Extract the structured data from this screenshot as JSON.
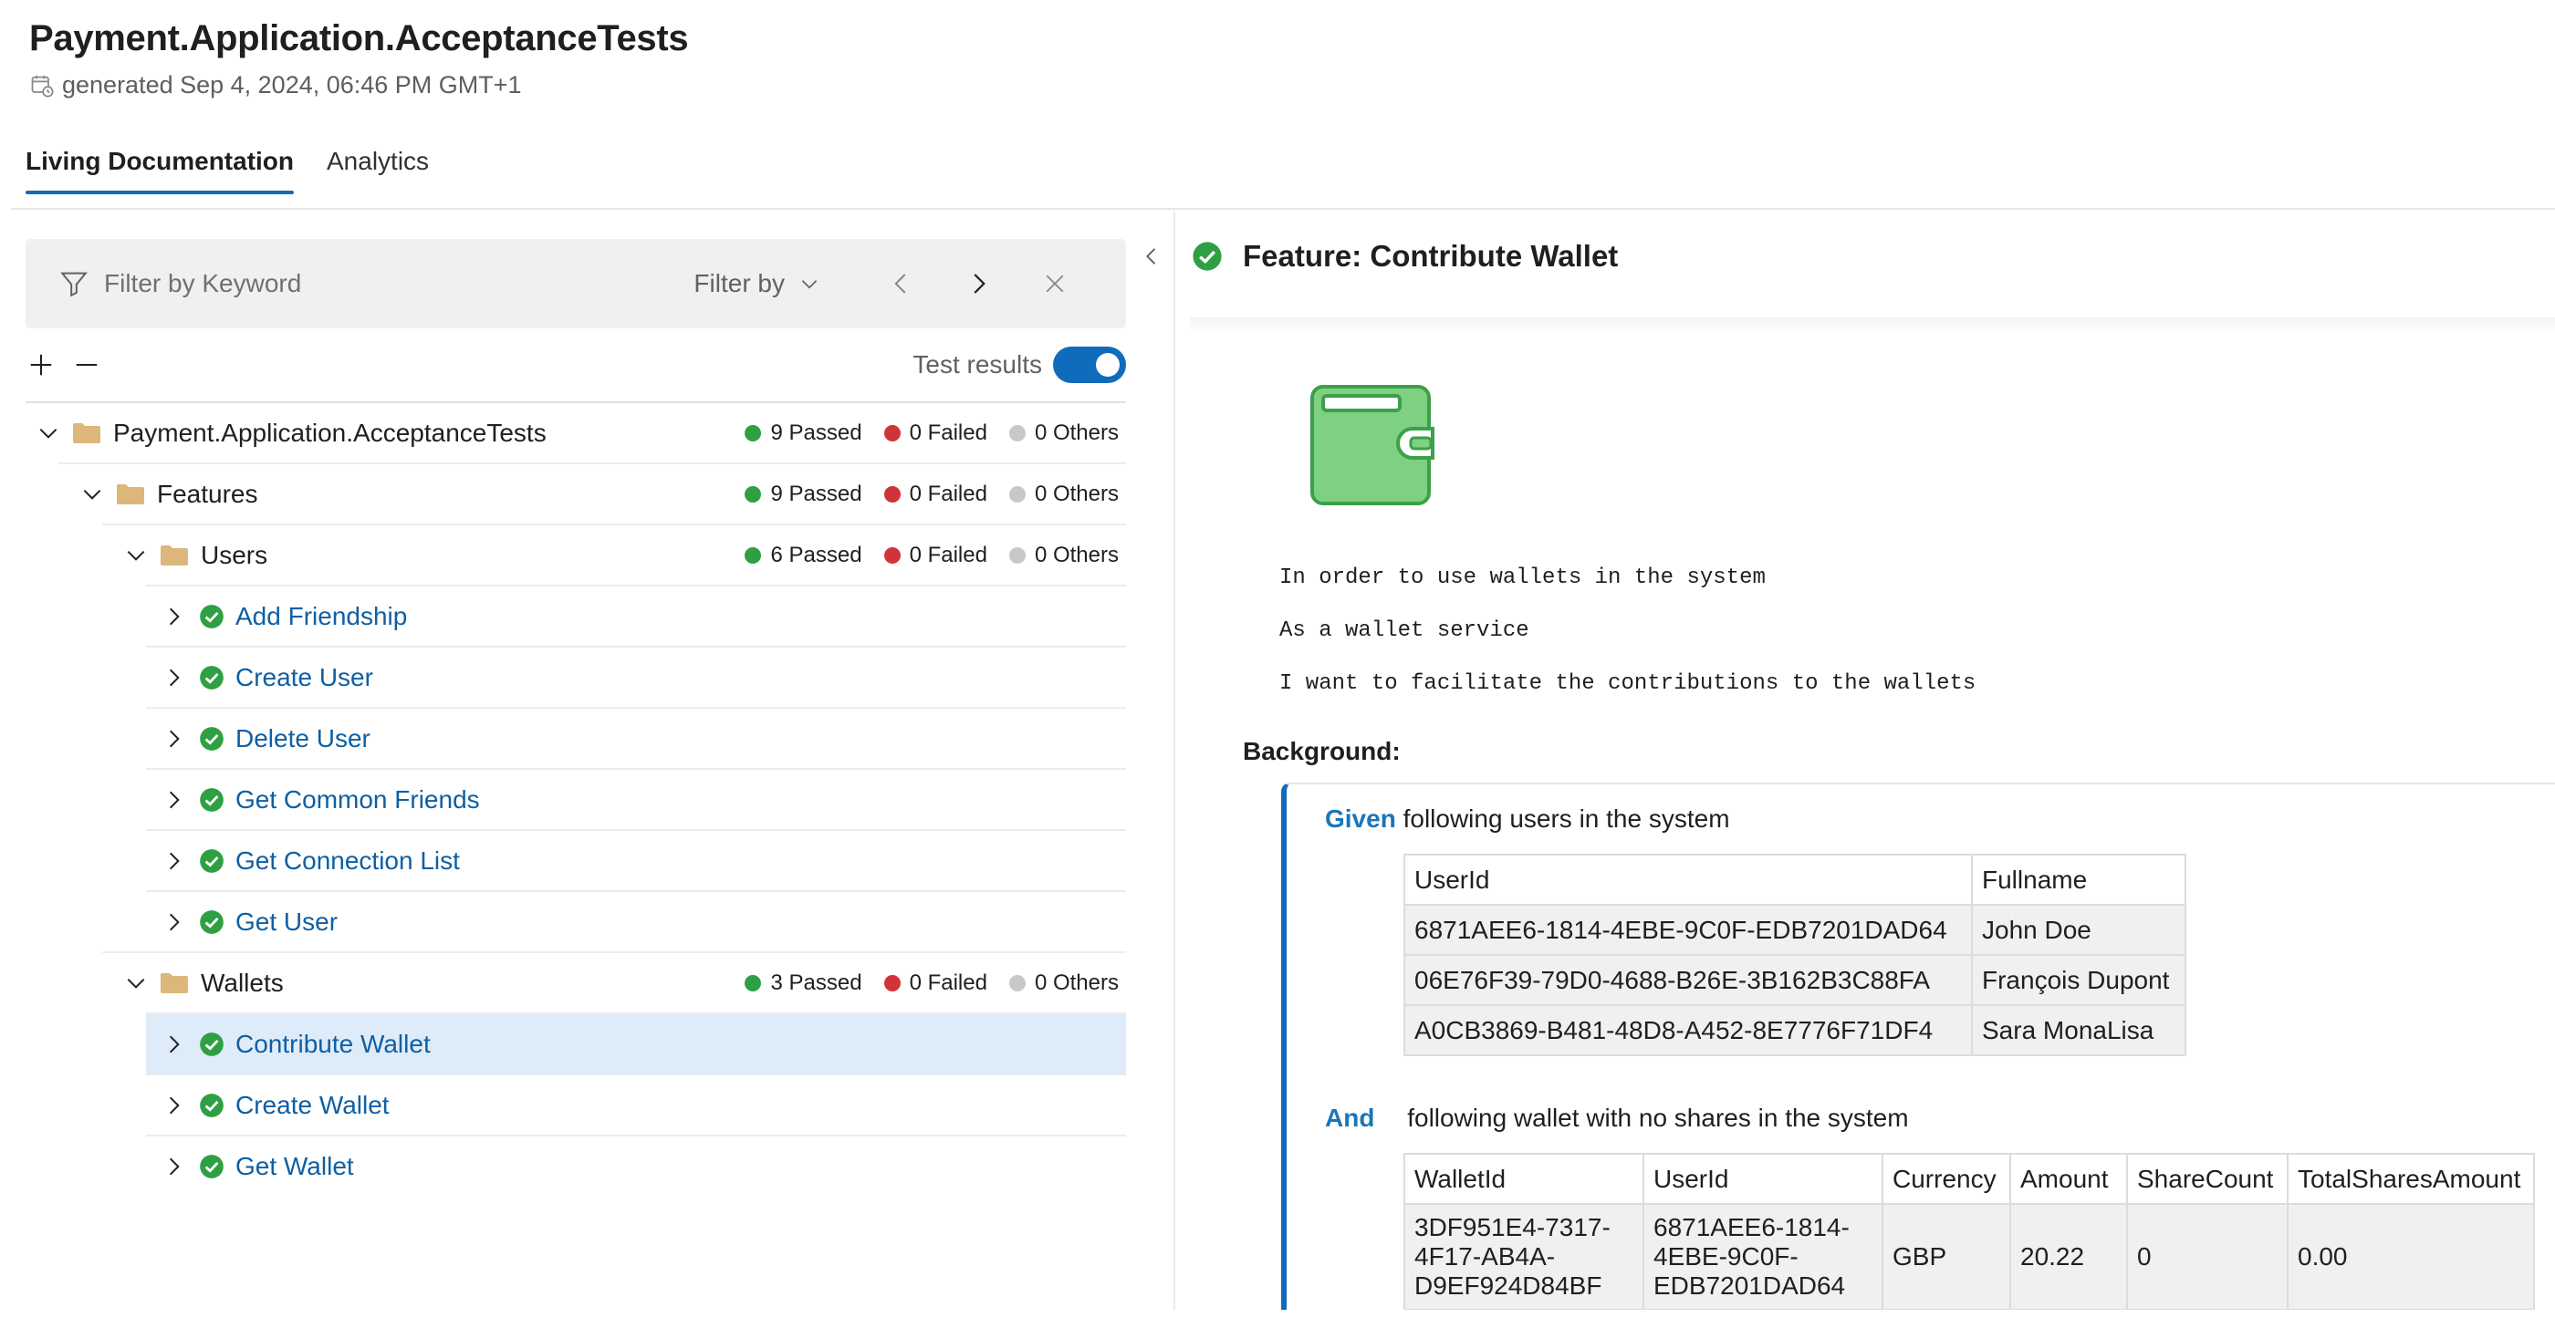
{
  "header": {
    "title": "Payment.Application.AcceptanceTests",
    "generated": "generated Sep 4, 2024, 06:46 PM GMT+1"
  },
  "tabs": [
    {
      "label": "Living Documentation",
      "active": true
    },
    {
      "label": "Analytics",
      "active": false
    }
  ],
  "filter": {
    "placeholder": "Filter by Keyword",
    "filter_by": "Filter by"
  },
  "test_results_label": "Test results",
  "colors": {
    "accent": "#0f6cbd",
    "passed": "#2ea043",
    "failed": "#d13438",
    "others": "#c8c8c8",
    "selected_row": "#deecf9",
    "link": "#0f5fa3"
  },
  "tree": {
    "root": {
      "label": "Payment.Application.AcceptanceTests",
      "passed": "9 Passed",
      "failed": "0 Failed",
      "others": "0 Others"
    },
    "features": {
      "label": "Features",
      "passed": "9 Passed",
      "failed": "0 Failed",
      "others": "0 Others"
    },
    "users": {
      "label": "Users",
      "passed": "6 Passed",
      "failed": "0 Failed",
      "others": "0 Others",
      "items": [
        "Add Friendship",
        "Create User",
        "Delete User",
        "Get Common Friends",
        "Get Connection List",
        "Get User"
      ]
    },
    "wallets": {
      "label": "Wallets",
      "passed": "3 Passed",
      "failed": "0 Failed",
      "others": "0 Others",
      "items": [
        "Contribute Wallet",
        "Create Wallet",
        "Get Wallet"
      ]
    }
  },
  "feature": {
    "title": "Feature:  Contribute Wallet",
    "description": [
      "In order to use wallets in the system",
      "As a wallet service",
      "I want to facilitate the contributions to the wallets"
    ],
    "background_label": "Background:",
    "step1": {
      "keyword": "Given",
      "text": "following users in the system",
      "headers": [
        "UserId",
        "Fullname"
      ],
      "rows": [
        [
          "6871AEE6-1814-4EBE-9C0F-EDB7201DAD64",
          "John Doe"
        ],
        [
          "06E76F39-79D0-4688-B26E-3B162B3C88FA",
          "François Dupont"
        ],
        [
          "A0CB3869-B481-48D8-A452-8E7776F71DF4",
          "Sara MonaLisa"
        ]
      ]
    },
    "step2": {
      "keyword": "And",
      "text": "following wallet with no shares in the system",
      "headers": [
        "WalletId",
        "UserId",
        "Currency",
        "Amount",
        "ShareCount",
        "TotalSharesAmount"
      ],
      "row": {
        "wallet_id": [
          "3DF951E4-7317-",
          "4F17-AB4A-",
          "D9EF924D84BF"
        ],
        "user_id": [
          "6871AEE6-1814-",
          "4EBE-9C0F-",
          "EDB7201DAD64"
        ],
        "currency": "GBP",
        "amount": "20.22",
        "share_count": "0",
        "total_shares_amount": "0.00"
      }
    }
  }
}
